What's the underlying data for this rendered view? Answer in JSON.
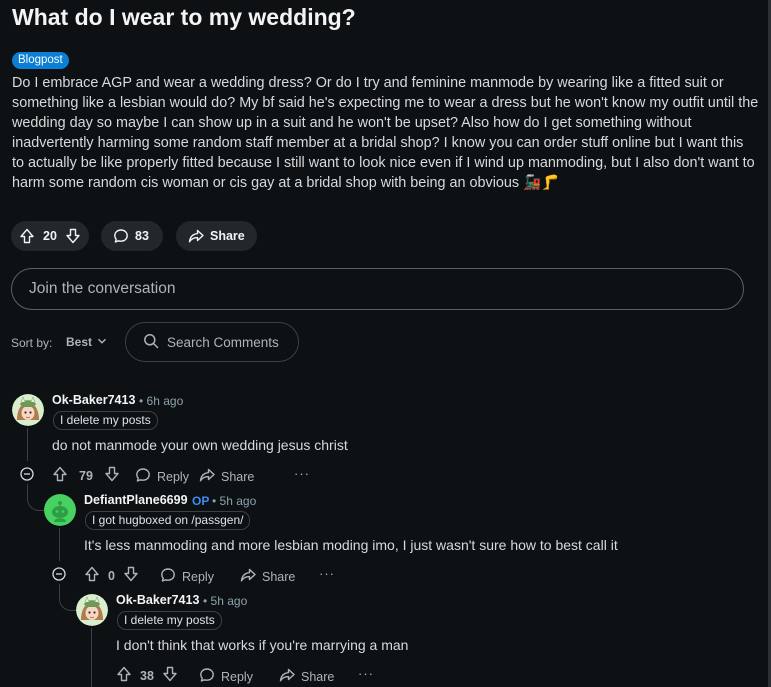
{
  "post": {
    "title": "What do I wear to my wedding?",
    "flair": "Blogpost",
    "flair_color": "#0b7fd6",
    "body_lines": [
      "Do I embrace AGP and wear a wedding dress? Or do I try and feminine manmode by wearing like a fitted suit or",
      "something like a lesbian would do? My bf said he's expecting me to wear a dress but he won't know my outfit until the",
      "wedding day so maybe I can show up in a suit and he won't be upset? Also how do I get something without",
      "inadvertently harming some random staff member at a bridal shop? I know you can order stuff online but I want this",
      "to actually be like properly fitted because I still want to look nice even if I wind up manmoding, but I also don't want to",
      "harm some random cis woman or cis gay at a bridal shop with being an obvious"
    ],
    "emoji": "🚂🦵",
    "votes": "20",
    "comments": "83",
    "share_label": "Share"
  },
  "join": {
    "placeholder": "Join the conversation"
  },
  "sort": {
    "label": "Sort by:",
    "value": "Best"
  },
  "search": {
    "placeholder": "Search Comments"
  },
  "comments": [
    {
      "username": "Ok-Baker7413",
      "time": "6h ago",
      "flair": "I delete my posts",
      "text": "do not manmode your own wedding jesus christ",
      "votes": "79",
      "reply_label": "Reply",
      "share_label": "Share",
      "more": "···"
    },
    {
      "username": "DefiantPlane6699",
      "op": "OP",
      "time": "5h ago",
      "flair": "I got hugboxed on /passgen/",
      "text": "It's less manmoding and more lesbian moding imo, I just wasn't sure how to best call it",
      "votes": "0",
      "reply_label": "Reply",
      "share_label": "Share",
      "more": "···"
    },
    {
      "username": "Ok-Baker7413",
      "time": "5h ago",
      "flair": "I delete my posts",
      "text": "I don't think that works if you're marrying a man",
      "votes": "38",
      "reply_label": "Reply",
      "share_label": "Share",
      "more": "···"
    }
  ],
  "meta_sep": "•",
  "icons": {
    "upvote": "arrow-up-outline-icon",
    "downvote": "arrow-down-outline-icon",
    "comment": "speech-bubble-icon",
    "share": "share-arrow-icon",
    "search": "magnifier-icon",
    "collapse": "minus-circle-icon"
  },
  "colors": {
    "background": "#0e1113",
    "op_tag": "#3d8bf5",
    "snoo_green": "#46d160"
  }
}
